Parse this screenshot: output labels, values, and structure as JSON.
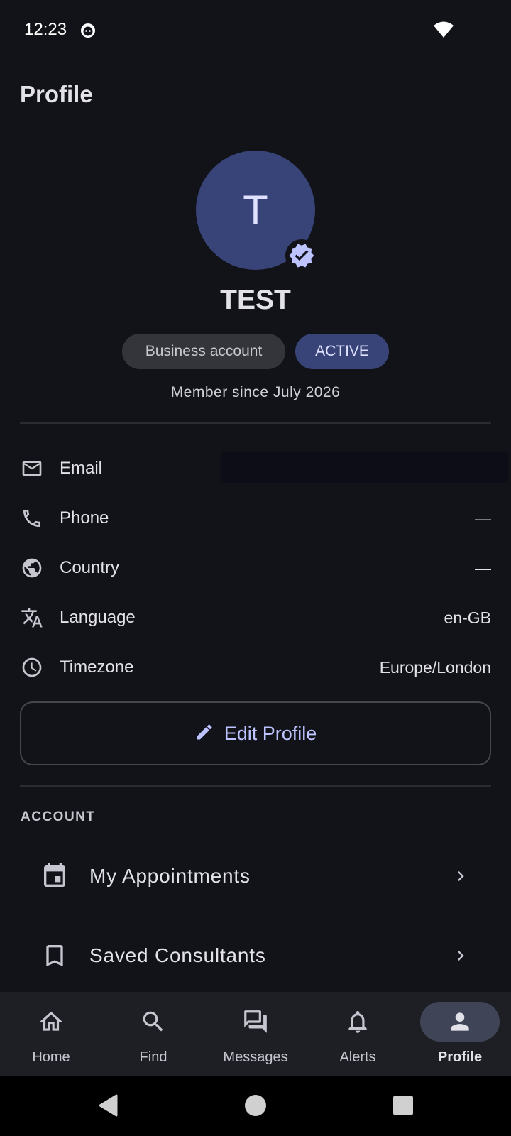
{
  "status_bar": {
    "time": "12:23"
  },
  "page": {
    "title": "Profile"
  },
  "profile": {
    "avatar_initial": "T",
    "name": "TEST",
    "account_type": "Business account",
    "status": "ACTIVE",
    "member_since": "Member since July 2026"
  },
  "info": {
    "email_label": "Email",
    "phone_label": "Phone",
    "phone_value": "—",
    "country_label": "Country",
    "country_value": "—",
    "language_label": "Language",
    "language_value": "en-GB",
    "timezone_label": "Timezone",
    "timezone_value": "Europe/London"
  },
  "edit_button": {
    "label": "Edit Profile"
  },
  "account_section": {
    "header": "ACCOUNT",
    "items": [
      {
        "label": "My Appointments",
        "icon": "calendar-icon"
      },
      {
        "label": "Saved Consultants",
        "icon": "bookmark-icon"
      }
    ]
  },
  "bottom_nav": {
    "items": [
      {
        "label": "Home",
        "icon": "home-icon"
      },
      {
        "label": "Find",
        "icon": "search-icon"
      },
      {
        "label": "Messages",
        "icon": "messages-icon"
      },
      {
        "label": "Alerts",
        "icon": "bell-icon"
      },
      {
        "label": "Profile",
        "icon": "person-icon",
        "active": true
      }
    ]
  },
  "colors": {
    "background": "#121318",
    "accent": "#bcc3ff",
    "avatar_bg": "#384478",
    "nav_bg": "#1e1f25"
  }
}
